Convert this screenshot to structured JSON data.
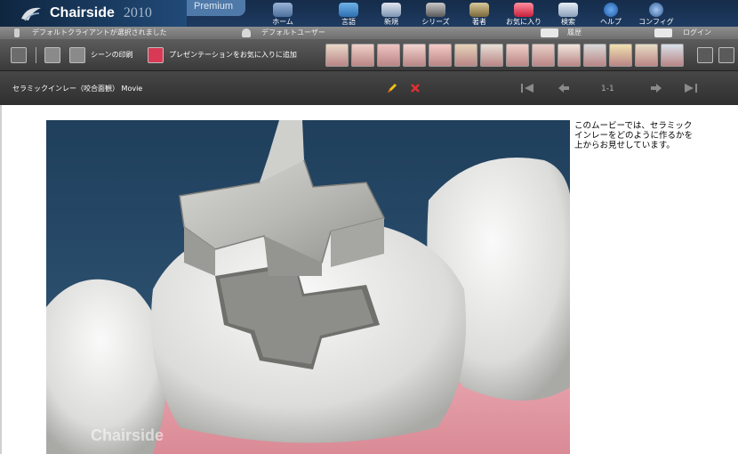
{
  "app": {
    "name": "Chairside",
    "year": "2010",
    "edition": "Premium"
  },
  "nav": [
    {
      "id": "home",
      "label": "ホーム",
      "icon": "house-icon"
    },
    {
      "id": "language",
      "label": "言語",
      "icon": "globe-icon"
    },
    {
      "id": "new",
      "label": "新規",
      "icon": "new-document-icon"
    },
    {
      "id": "series",
      "label": "シリーズ",
      "icon": "film-icon"
    },
    {
      "id": "author",
      "label": "著者",
      "icon": "pen-icon"
    },
    {
      "id": "favorites",
      "label": "お気に入り",
      "icon": "heart-icon"
    },
    {
      "id": "search",
      "label": "検索",
      "icon": "search-icon"
    },
    {
      "id": "help",
      "label": "ヘルプ",
      "icon": "help-icon"
    },
    {
      "id": "config",
      "label": "コンフィグ",
      "icon": "gear-icon"
    }
  ],
  "status": {
    "client": "デフォルトクライアントが選択されました",
    "user": "デフォルトユーザー",
    "history": "履歴",
    "login": "ログイン"
  },
  "toolbar": {
    "print_label": "シーンの印刷",
    "favorite_label": "プレゼンテーションをお気に入りに追加",
    "thumbnails": [
      "dental-thumb-1",
      "dental-thumb-2",
      "dental-thumb-3",
      "dental-thumb-4",
      "dental-thumb-5",
      "dental-thumb-6",
      "dental-thumb-7",
      "dental-thumb-8",
      "dental-thumb-9",
      "dental-thumb-10",
      "dental-thumb-11",
      "dental-thumb-12",
      "dental-thumb-13",
      "dental-thumb-14"
    ]
  },
  "presentation": {
    "title": "セラミックインレー（咬合面観） Movie",
    "page": "1-1"
  },
  "content": {
    "description": "このムービーでは、セラミックインレーをどのように作るかを上からお見せしています。",
    "watermark": "Chairside"
  },
  "colors": {
    "header": "#1e3b61",
    "toolbar": "#4a4a4a",
    "title_bar": "#3a3a3a",
    "video_bg": "#2b4d6b",
    "gum": "#e8a0a8"
  }
}
